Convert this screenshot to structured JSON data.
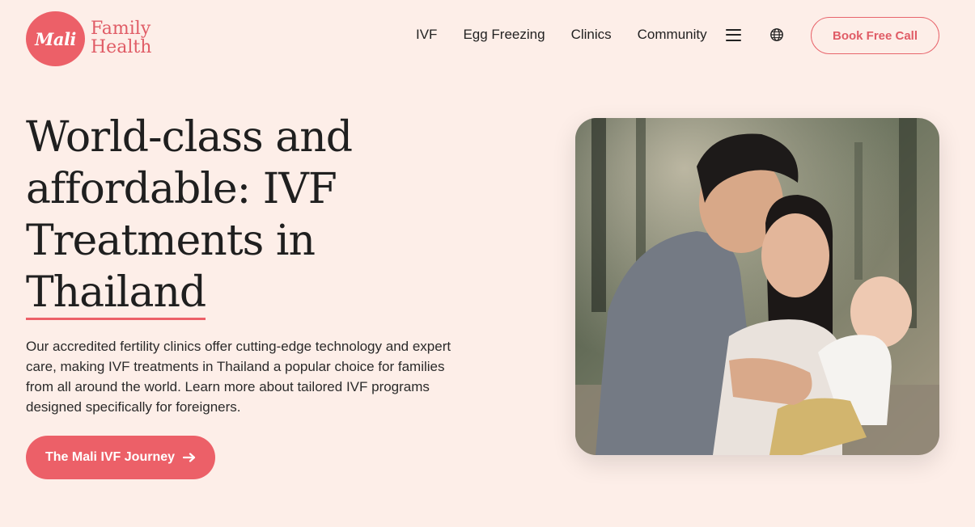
{
  "brand": {
    "badge_text": "Mali",
    "name_line1": "Family",
    "name_line2": "Health",
    "accent_color": "#ec6068",
    "background_color": "#fdeee8"
  },
  "nav": {
    "items": [
      {
        "label": "IVF"
      },
      {
        "label": "Egg Freezing"
      },
      {
        "label": "Clinics"
      },
      {
        "label": "Community"
      }
    ],
    "menu_icon": "hamburger-menu-icon",
    "language_icon": "globe-icon",
    "cta_label": "Book Free Call"
  },
  "hero": {
    "title_lines": [
      "World-class and",
      "affordable: IVF",
      "Treatments in",
      "Thailand"
    ],
    "description": "Our accredited fertility clinics offer cutting-edge technology and expert care, making IVF treatments in Thailand a popular choice for families from all around the world. Learn more about tailored IVF programs designed specifically for foreigners.",
    "cta_label": "The Mali IVF Journey",
    "cta_icon": "arrow-right-icon",
    "photo_alt": "Family photo"
  }
}
